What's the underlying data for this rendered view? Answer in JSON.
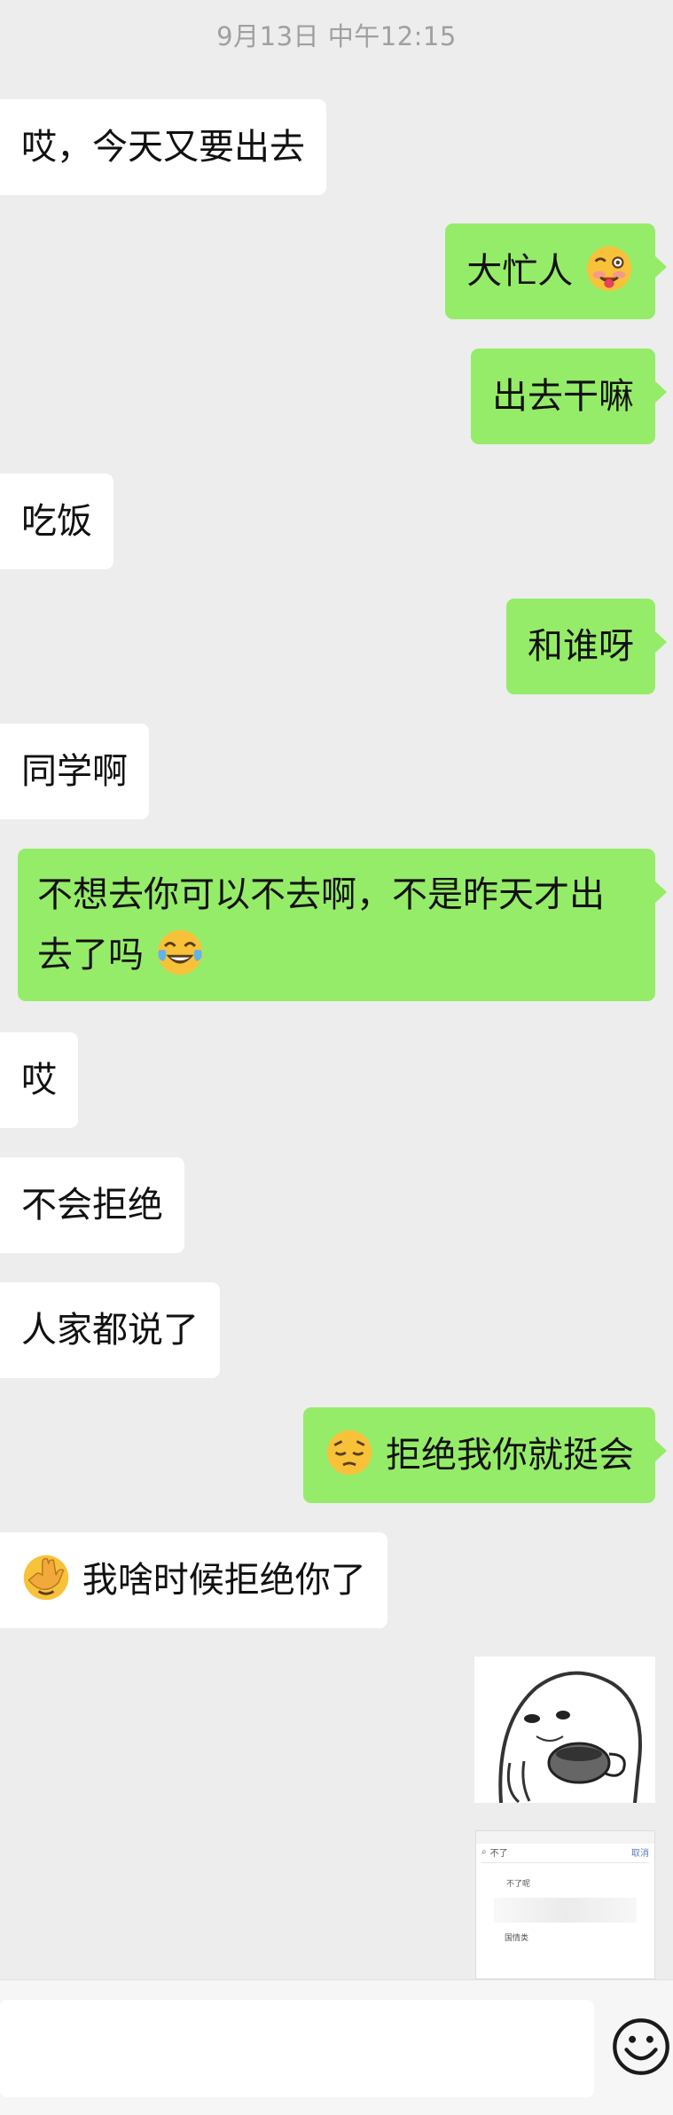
{
  "timestamp": "9月13日 中午12:15",
  "messages": [
    {
      "text": "哎，今天又要出去"
    },
    {
      "text": "大忙人"
    },
    {
      "text": "出去干嘛"
    },
    {
      "text": "吃饭"
    },
    {
      "text": "和谁呀"
    },
    {
      "text": "同学啊"
    },
    {
      "text": "不想去你可以不去啊，不是昨天才出去了吗"
    },
    {
      "text": "哎"
    },
    {
      "text": "不会拒绝"
    },
    {
      "text": "人家都说了"
    },
    {
      "text": "拒绝我你就挺会"
    },
    {
      "text": "我啥时候拒绝你了"
    }
  ],
  "screenshot_card": {
    "search_text": "不了",
    "cancel_label": "取消",
    "line1": "不了呢",
    "line2": "国情类"
  },
  "input": {
    "value": ""
  },
  "colors": {
    "background": "#ededed",
    "outgoing_bubble": "#95ec69",
    "incoming_bubble": "#ffffff"
  },
  "icons": {
    "emoji_button": "smiley-icon"
  }
}
